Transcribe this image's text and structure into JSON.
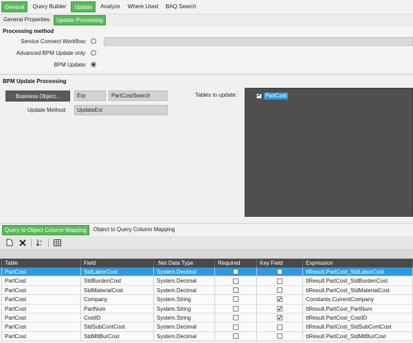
{
  "top_tabs": [
    "General",
    "Query Builder",
    "Update",
    "Analyze",
    "Where Used",
    "BAQ Search"
  ],
  "sub_tabs": [
    "General Properties",
    "Update Processing"
  ],
  "processing_method": {
    "title": "Processing method",
    "options": [
      {
        "label": "Service Connect Workflow:",
        "selected": false
      },
      {
        "label": "Advanced BPM Update only:",
        "selected": false
      },
      {
        "label": "BPM Update:",
        "selected": true
      }
    ]
  },
  "bpm_update": {
    "title": "BPM Update Processing",
    "business_object_button": "Business Object...",
    "bo_field1": "Erp",
    "bo_field2": "PartCostSearch",
    "update_method_label": "Update Method:",
    "update_method_value": "UpdateExt",
    "tables_label": "Tables to update:",
    "tables": [
      {
        "name": "PartCost",
        "checked": true
      }
    ]
  },
  "lower_tabs": [
    "Query to Object Column Mapping",
    "Object to Query Column Mapping"
  ],
  "toolbar_icons": [
    "new-icon",
    "delete-icon",
    "sort-icon",
    "grid-settings-icon"
  ],
  "grid": {
    "columns": [
      "Table",
      "Field",
      ".Net Data Type",
      "Required",
      "Key Field",
      "Expression"
    ],
    "rows": [
      {
        "table": "PartCost",
        "field": "StdLaborCost",
        "type": "System.Decimal",
        "required": false,
        "key": false,
        "expression": "ttResult.PartCost_StdLaborCost"
      },
      {
        "table": "PartCost",
        "field": "StdBurdenCost",
        "type": "System.Decimal",
        "required": false,
        "key": false,
        "expression": "ttResult.PartCost_StdBurdenCost"
      },
      {
        "table": "PartCost",
        "field": "StdMaterialCost",
        "type": "System.Decimal",
        "required": false,
        "key": false,
        "expression": "ttResult.PartCost_StdMaterialCost"
      },
      {
        "table": "PartCost",
        "field": "Company",
        "type": "System.String",
        "required": false,
        "key": true,
        "expression": "Constants.CurrentCompany"
      },
      {
        "table": "PartCost",
        "field": "PartNum",
        "type": "System.String",
        "required": false,
        "key": true,
        "expression": "ttResult.PartCost_PartNum"
      },
      {
        "table": "PartCost",
        "field": "CostID",
        "type": "System.String",
        "required": false,
        "key": true,
        "expression": "ttResult.PartCost_CostID"
      },
      {
        "table": "PartCost",
        "field": "StdSubContCost",
        "type": "System.Decimal",
        "required": false,
        "key": false,
        "expression": "ttResult.PartCost_StdSubContCost"
      },
      {
        "table": "PartCost",
        "field": "StdMtlBurCost",
        "type": "System.Decimal",
        "required": false,
        "key": false,
        "expression": "ttResult.PartCost_StdMtlBurCost"
      }
    ]
  }
}
